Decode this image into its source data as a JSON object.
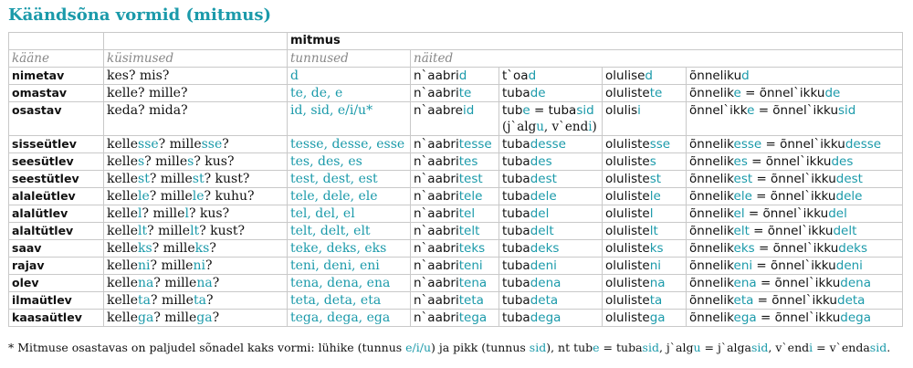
{
  "title": "Käändsõna vormid (mitmus)",
  "table": {
    "number_header": "mitmus",
    "headers": [
      "kääne",
      "küsimused",
      "tunnused",
      "näited"
    ],
    "rows": [
      {
        "case": "nimetav",
        "question": [
          [
            "kes? mis?",
            ""
          ]
        ],
        "markers": "d",
        "ex1": [
          [
            "n`aabri",
            ""
          ],
          [
            "d",
            "hl"
          ]
        ],
        "ex2": [
          [
            "t`oa",
            ""
          ],
          [
            "d",
            "hl"
          ]
        ],
        "ex3": [
          [
            "olulise",
            ""
          ],
          [
            "d",
            "hl"
          ]
        ],
        "ex4": [
          [
            "õnneliku",
            ""
          ],
          [
            "d",
            "hl"
          ]
        ]
      },
      {
        "case": "omastav",
        "question": [
          [
            "kelle? mille?",
            ""
          ]
        ],
        "markers": "te, de, e",
        "ex1": [
          [
            "n`aabri",
            ""
          ],
          [
            "te",
            "hl"
          ]
        ],
        "ex2": [
          [
            "tuba",
            ""
          ],
          [
            "de",
            "hl"
          ]
        ],
        "ex3": [
          [
            "oluliste",
            ""
          ],
          [
            "te",
            "hl"
          ]
        ],
        "ex4": [
          [
            "õnnelik",
            ""
          ],
          [
            "e",
            "hl"
          ],
          [
            " = õnnel`ikku",
            ""
          ],
          [
            "de",
            "hl"
          ]
        ]
      },
      {
        "case": "osastav",
        "question": [
          [
            "keda? mida?",
            ""
          ]
        ],
        "markers": "id, sid, e/i/u*",
        "ex1": [
          [
            "n`aabre",
            ""
          ],
          [
            "id",
            "hl"
          ]
        ],
        "ex2": [
          [
            "tub",
            ""
          ],
          [
            "e",
            "hl"
          ],
          [
            " = tuba",
            ""
          ],
          [
            "sid",
            "hl"
          ]
        ],
        "ex2_line2": [
          [
            "(j`alg",
            ""
          ],
          [
            "u",
            "hl"
          ],
          [
            ", v`end",
            ""
          ],
          [
            "i",
            "hl"
          ],
          [
            ")",
            ""
          ]
        ],
        "ex3": [
          [
            "olulis",
            ""
          ],
          [
            "i",
            "hl"
          ]
        ],
        "ex4": [
          [
            "õnnel`ikk",
            ""
          ],
          [
            "e",
            "hl"
          ],
          [
            " = õnnel`ikku",
            ""
          ],
          [
            "sid",
            "hl"
          ]
        ]
      },
      {
        "case": "sisseütlev",
        "question": [
          [
            "kelle",
            ""
          ],
          [
            "sse",
            "hl"
          ],
          [
            "? mille",
            ""
          ],
          [
            "sse",
            "hl"
          ],
          [
            "?",
            ""
          ]
        ],
        "markers": "tesse, desse, esse",
        "ex1": [
          [
            "n`aabri",
            ""
          ],
          [
            "tesse",
            "hl"
          ]
        ],
        "ex2": [
          [
            "tuba",
            ""
          ],
          [
            "desse",
            "hl"
          ]
        ],
        "ex3": [
          [
            "oluliste",
            ""
          ],
          [
            "sse",
            "hl"
          ]
        ],
        "ex4": [
          [
            "õnnelik",
            ""
          ],
          [
            "esse",
            "hl"
          ],
          [
            " = õnnel`ikku",
            ""
          ],
          [
            "desse",
            "hl"
          ]
        ]
      },
      {
        "case": "seesütlev",
        "question": [
          [
            "kelle",
            ""
          ],
          [
            "s",
            "hl"
          ],
          [
            "? mille",
            ""
          ],
          [
            "s",
            "hl"
          ],
          [
            "? kus?",
            ""
          ]
        ],
        "markers": "tes, des, es",
        "ex1": [
          [
            "n`aabri",
            ""
          ],
          [
            "tes",
            "hl"
          ]
        ],
        "ex2": [
          [
            "tuba",
            ""
          ],
          [
            "des",
            "hl"
          ]
        ],
        "ex3": [
          [
            "oluliste",
            ""
          ],
          [
            "s",
            "hl"
          ]
        ],
        "ex4": [
          [
            "õnnelik",
            ""
          ],
          [
            "es",
            "hl"
          ],
          [
            " = õnnel`ikku",
            ""
          ],
          [
            "des",
            "hl"
          ]
        ]
      },
      {
        "case": "seestütlev",
        "question": [
          [
            "kelle",
            ""
          ],
          [
            "st",
            "hl"
          ],
          [
            "? mille",
            ""
          ],
          [
            "st",
            "hl"
          ],
          [
            "? kust?",
            ""
          ]
        ],
        "markers": "test, dest, est",
        "ex1": [
          [
            "n`aabri",
            ""
          ],
          [
            "test",
            "hl"
          ]
        ],
        "ex2": [
          [
            "tuba",
            ""
          ],
          [
            "dest",
            "hl"
          ]
        ],
        "ex3": [
          [
            "oluliste",
            ""
          ],
          [
            "st",
            "hl"
          ]
        ],
        "ex4": [
          [
            "õnnelik",
            ""
          ],
          [
            "est",
            "hl"
          ],
          [
            " = õnnel`ikku",
            ""
          ],
          [
            "dest",
            "hl"
          ]
        ]
      },
      {
        "case": "alaleütlev",
        "question": [
          [
            "kelle",
            ""
          ],
          [
            "le",
            "hl"
          ],
          [
            "? mille",
            ""
          ],
          [
            "le",
            "hl"
          ],
          [
            "? kuhu?",
            ""
          ]
        ],
        "markers": "tele, dele, ele",
        "ex1": [
          [
            "n`aabri",
            ""
          ],
          [
            "tele",
            "hl"
          ]
        ],
        "ex2": [
          [
            "tuba",
            ""
          ],
          [
            "dele",
            "hl"
          ]
        ],
        "ex3": [
          [
            "oluliste",
            ""
          ],
          [
            "le",
            "hl"
          ]
        ],
        "ex4": [
          [
            "õnnelik",
            ""
          ],
          [
            "ele",
            "hl"
          ],
          [
            " = õnnel`ikku",
            ""
          ],
          [
            "dele",
            "hl"
          ]
        ]
      },
      {
        "case": "alalütlev",
        "question": [
          [
            "kelle",
            ""
          ],
          [
            "l",
            "hl"
          ],
          [
            "? mille",
            ""
          ],
          [
            "l",
            "hl"
          ],
          [
            "? kus?",
            ""
          ]
        ],
        "markers": "tel, del, el",
        "ex1": [
          [
            "n`aabri",
            ""
          ],
          [
            "tel",
            "hl"
          ]
        ],
        "ex2": [
          [
            "tuba",
            ""
          ],
          [
            "del",
            "hl"
          ]
        ],
        "ex3": [
          [
            "oluliste",
            ""
          ],
          [
            "l",
            "hl"
          ]
        ],
        "ex4": [
          [
            "õnnelik",
            ""
          ],
          [
            "el",
            "hl"
          ],
          [
            " = õnnel`ikku",
            ""
          ],
          [
            "del",
            "hl"
          ]
        ]
      },
      {
        "case": "alaltütlev",
        "question": [
          [
            "kelle",
            ""
          ],
          [
            "lt",
            "hl"
          ],
          [
            "? mille",
            ""
          ],
          [
            "lt",
            "hl"
          ],
          [
            "? kust?",
            ""
          ]
        ],
        "markers": "telt, delt, elt",
        "ex1": [
          [
            "n`aabri",
            ""
          ],
          [
            "telt",
            "hl"
          ]
        ],
        "ex2": [
          [
            "tuba",
            ""
          ],
          [
            "delt",
            "hl"
          ]
        ],
        "ex3": [
          [
            "oluliste",
            ""
          ],
          [
            "lt",
            "hl"
          ]
        ],
        "ex4": [
          [
            "õnnelik",
            ""
          ],
          [
            "elt",
            "hl"
          ],
          [
            " = õnnel`ikku",
            ""
          ],
          [
            "delt",
            "hl"
          ]
        ]
      },
      {
        "case": "saav",
        "question": [
          [
            "kelle",
            ""
          ],
          [
            "ks",
            "hl"
          ],
          [
            "? mille",
            ""
          ],
          [
            "ks",
            "hl"
          ],
          [
            "?",
            ""
          ]
        ],
        "markers": "teke, deks, eks",
        "ex1": [
          [
            "n`aabri",
            ""
          ],
          [
            "teks",
            "hl"
          ]
        ],
        "ex2": [
          [
            "tuba",
            ""
          ],
          [
            "deks",
            "hl"
          ]
        ],
        "ex3": [
          [
            "oluliste",
            ""
          ],
          [
            "ks",
            "hl"
          ]
        ],
        "ex4": [
          [
            "õnnelik",
            ""
          ],
          [
            "eks",
            "hl"
          ],
          [
            " = õnnel`ikku",
            ""
          ],
          [
            "deks",
            "hl"
          ]
        ]
      },
      {
        "case": "rajav",
        "question": [
          [
            "kelle",
            ""
          ],
          [
            "ni",
            "hl"
          ],
          [
            "? mille",
            ""
          ],
          [
            "ni",
            "hl"
          ],
          [
            "?",
            ""
          ]
        ],
        "markers": "teni, deni, eni",
        "ex1": [
          [
            "n`aabri",
            ""
          ],
          [
            "teni",
            "hl"
          ]
        ],
        "ex2": [
          [
            "tuba",
            ""
          ],
          [
            "deni",
            "hl"
          ]
        ],
        "ex3": [
          [
            "oluliste",
            ""
          ],
          [
            "ni",
            "hl"
          ]
        ],
        "ex4": [
          [
            "õnnelik",
            ""
          ],
          [
            "eni",
            "hl"
          ],
          [
            " = õnnel`ikku",
            ""
          ],
          [
            "deni",
            "hl"
          ]
        ]
      },
      {
        "case": "olev",
        "question": [
          [
            "kelle",
            ""
          ],
          [
            "na",
            "hl"
          ],
          [
            "? mille",
            ""
          ],
          [
            "na",
            "hl"
          ],
          [
            "?",
            ""
          ]
        ],
        "markers": "tena, dena, ena",
        "ex1": [
          [
            "n`aabri",
            ""
          ],
          [
            "tena",
            "hl"
          ]
        ],
        "ex2": [
          [
            "tuba",
            ""
          ],
          [
            "dena",
            "hl"
          ]
        ],
        "ex3": [
          [
            "oluliste",
            ""
          ],
          [
            "na",
            "hl"
          ]
        ],
        "ex4": [
          [
            "õnnelik",
            ""
          ],
          [
            "ena",
            "hl"
          ],
          [
            " = õnnel`ikku",
            ""
          ],
          [
            "dena",
            "hl"
          ]
        ]
      },
      {
        "case": "ilmaütlev",
        "question": [
          [
            "kelle",
            ""
          ],
          [
            "ta",
            "hl"
          ],
          [
            "? mille",
            ""
          ],
          [
            "ta",
            "hl"
          ],
          [
            "?",
            ""
          ]
        ],
        "markers": "teta, deta, eta",
        "ex1": [
          [
            "n`aabri",
            ""
          ],
          [
            "teta",
            "hl"
          ]
        ],
        "ex2": [
          [
            "tuba",
            ""
          ],
          [
            "deta",
            "hl"
          ]
        ],
        "ex3": [
          [
            "oluliste",
            ""
          ],
          [
            "ta",
            "hl"
          ]
        ],
        "ex4": [
          [
            "õnnelik",
            ""
          ],
          [
            "eta",
            "hl"
          ],
          [
            " = õnnel`ikku",
            ""
          ],
          [
            "deta",
            "hl"
          ]
        ]
      },
      {
        "case": "kaasaütlev",
        "question": [
          [
            "kelle",
            ""
          ],
          [
            "ga",
            "hl"
          ],
          [
            "? mille",
            ""
          ],
          [
            "ga",
            "hl"
          ],
          [
            "?",
            ""
          ]
        ],
        "markers": "tega, dega, ega",
        "ex1": [
          [
            "n`aabri",
            ""
          ],
          [
            "tega",
            "hl"
          ]
        ],
        "ex2": [
          [
            "tuba",
            ""
          ],
          [
            "dega",
            "hl"
          ]
        ],
        "ex3": [
          [
            "oluliste",
            ""
          ],
          [
            "ga",
            "hl"
          ]
        ],
        "ex4": [
          [
            "õnnelik",
            ""
          ],
          [
            "ega",
            "hl"
          ],
          [
            " = õnnel`ikku",
            ""
          ],
          [
            "dega",
            "hl"
          ]
        ]
      }
    ]
  },
  "footnote": [
    [
      "* Mitmuse osastavas on paljudel sõnadel kaks vormi: lühike (tunnus ",
      ""
    ],
    [
      "e/i/u",
      "hl"
    ],
    [
      ") ja pikk (tunnus ",
      ""
    ],
    [
      "sid",
      "hl"
    ],
    [
      "), nt ",
      ""
    ],
    [
      "tub",
      "i"
    ],
    [
      "e",
      "i hl"
    ],
    [
      " = ",
      "i"
    ],
    [
      "tuba",
      "i"
    ],
    [
      "sid",
      "i hl"
    ],
    [
      ", ",
      ""
    ],
    [
      "j`alg",
      "i"
    ],
    [
      "u",
      "i hl"
    ],
    [
      " = ",
      "i"
    ],
    [
      "j`alga",
      "i"
    ],
    [
      "sid",
      "i hl"
    ],
    [
      ", ",
      ""
    ],
    [
      "v`end",
      "i"
    ],
    [
      "i",
      "i hl"
    ],
    [
      " = ",
      "i"
    ],
    [
      "v`enda",
      "i"
    ],
    [
      "sid",
      "i hl"
    ],
    [
      ".",
      ""
    ]
  ],
  "colors": {
    "accent": "#1b9aaa",
    "header_gray": "#888888",
    "border": "#c9c9c9"
  }
}
